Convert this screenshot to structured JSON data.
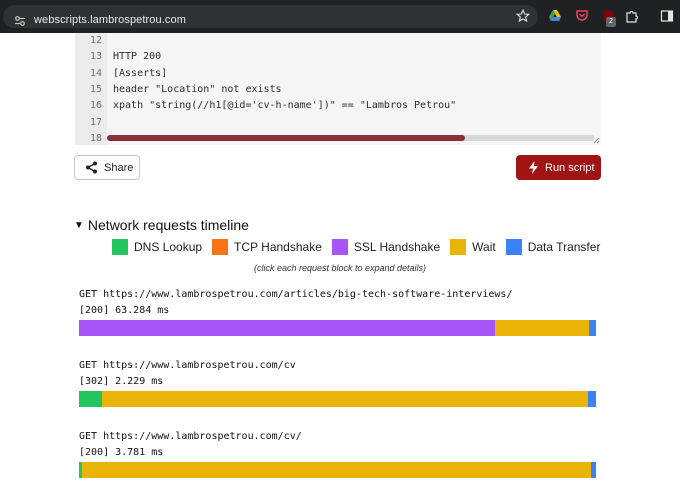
{
  "browser": {
    "url": "webscripts.lambrospetrou.com",
    "extension_badge": "2"
  },
  "editor": {
    "lines": [
      {
        "num": "12",
        "text": ""
      },
      {
        "num": "13",
        "text": "HTTP 200"
      },
      {
        "num": "14",
        "text": "[Asserts]"
      },
      {
        "num": "15",
        "text": "header \"Location\" not exists"
      },
      {
        "num": "16",
        "text": "xpath \"string(//h1[@id='cv-h-name'])\" == \"Lambros Petrou\""
      },
      {
        "num": "17",
        "text": ""
      },
      {
        "num": "18",
        "text": ""
      }
    ]
  },
  "actions": {
    "share_label": "Share",
    "run_label": "Run script"
  },
  "timeline": {
    "title": "Network requests timeline",
    "legend": [
      {
        "label": "DNS Lookup",
        "color": "#22c55e"
      },
      {
        "label": "TCP Handshake",
        "color": "#f97316"
      },
      {
        "label": "SSL Handshake",
        "color": "#a855f7"
      },
      {
        "label": "Wait",
        "color": "#eab308"
      },
      {
        "label": "Data Transfer",
        "color": "#3b82f6"
      }
    ],
    "hint": "(click each request block to expand details)",
    "requests": [
      {
        "url": "GET https://www.lambrospetrou.com/articles/big-tech-software-interviews/",
        "status": "[200] 63.284 ms",
        "phases": [
          {
            "phase": "DNS Lookup",
            "fraction": 0.0
          },
          {
            "phase": "TCP Handshake",
            "fraction": 0.0
          },
          {
            "phase": "SSL Handshake",
            "fraction": 0.804
          },
          {
            "phase": "Wait",
            "fraction": 0.182
          },
          {
            "phase": "Data Transfer",
            "fraction": 0.014
          }
        ]
      },
      {
        "url": "GET https://www.lambrospetrou.com/cv",
        "status": "[302] 2.229 ms",
        "phases": [
          {
            "phase": "DNS Lookup",
            "fraction": 0.045
          },
          {
            "phase": "TCP Handshake",
            "fraction": 0.0
          },
          {
            "phase": "SSL Handshake",
            "fraction": 0.0
          },
          {
            "phase": "Wait",
            "fraction": 0.94
          },
          {
            "phase": "Data Transfer",
            "fraction": 0.015
          }
        ]
      },
      {
        "url": "GET https://www.lambrospetrou.com/cv/",
        "status": "[200] 3.781 ms",
        "phases": [
          {
            "phase": "DNS Lookup",
            "fraction": 0.006
          },
          {
            "phase": "TCP Handshake",
            "fraction": 0.0
          },
          {
            "phase": "SSL Handshake",
            "fraction": 0.0
          },
          {
            "phase": "Wait",
            "fraction": 0.984
          },
          {
            "phase": "Data Transfer",
            "fraction": 0.01
          }
        ]
      }
    ]
  },
  "icons": {
    "site_settings": "tune-icon",
    "bookmark": "star-icon",
    "share": "share-icon",
    "run": "lightning-icon"
  }
}
